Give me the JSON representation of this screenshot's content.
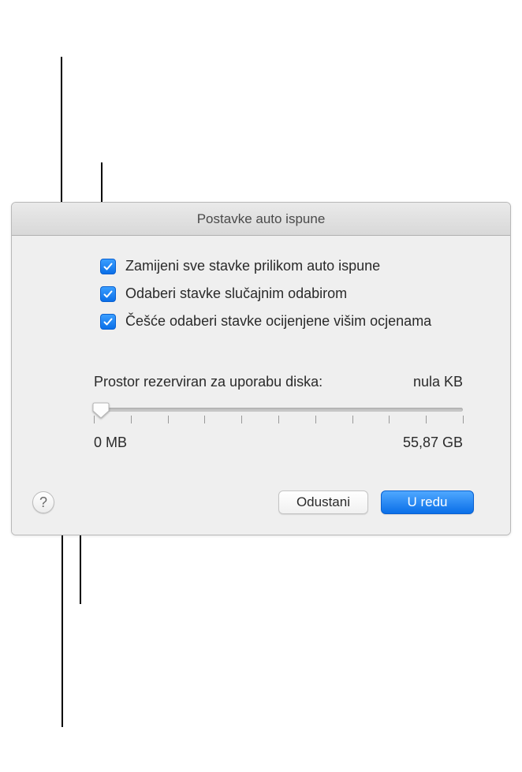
{
  "dialog": {
    "title": "Postavke auto ispune",
    "checkboxes": [
      {
        "label": "Zamijeni sve stavke prilikom auto ispune",
        "checked": true
      },
      {
        "label": "Odaberi stavke slučajnim odabirom",
        "checked": true
      },
      {
        "label": "Češće odaberi stavke ocijenjene višim ocjenama",
        "checked": true
      }
    ],
    "slider": {
      "label": "Prostor rezerviran za uporabu diska:",
      "value_text": "nula KB",
      "min_label": "0 MB",
      "max_label": "55,87 GB",
      "position_percent": 0
    },
    "buttons": {
      "cancel": "Odustani",
      "ok": "U redu",
      "help": "?"
    }
  }
}
